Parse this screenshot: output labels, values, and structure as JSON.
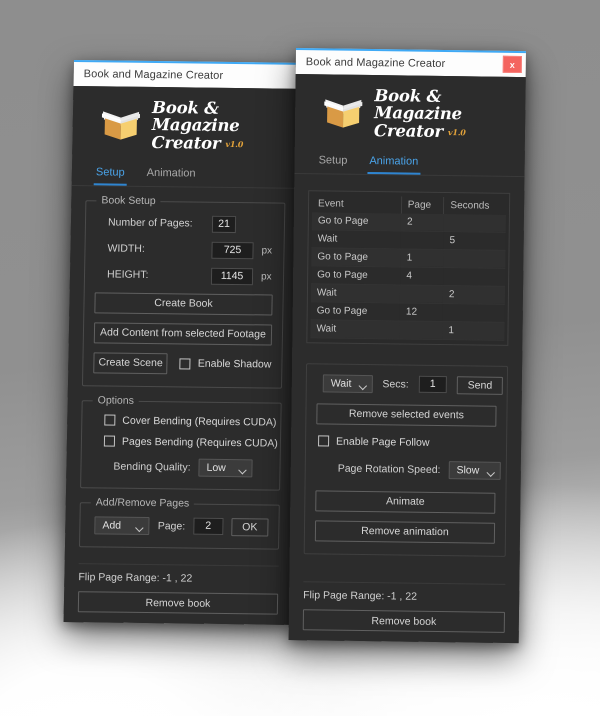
{
  "background": {
    "top_color": "#8e8e8e",
    "bottom_color": "#ffffff"
  },
  "theme": {
    "panel_bg": "#2c2c2c",
    "accent_blue": "#3fa9f5",
    "close_red": "#f4645f",
    "logo_orange": "#e2a23a"
  },
  "logo": {
    "line1": "Book & Magazine",
    "line2": "Creator",
    "version": "v1.0",
    "icon": "open-book-icon"
  },
  "left_window": {
    "titlebar": {
      "title": "Book and Magazine Creator"
    },
    "tabs": [
      {
        "label": "Setup",
        "active": true
      },
      {
        "label": "Animation",
        "active": false
      }
    ],
    "book_setup": {
      "title": "Book Setup",
      "pages_label": "Number of Pages:",
      "pages_value": "21",
      "width_label": "WIDTH:",
      "width_value": "725",
      "width_unit": "px",
      "height_label": "HEIGHT:",
      "height_value": "1145",
      "height_unit": "px",
      "create_book": "Create Book",
      "add_content": "Add Content from selected Footage",
      "create_scene": "Create Scene",
      "enable_shadow": "Enable Shadow",
      "enable_shadow_checked": false
    },
    "options": {
      "title": "Options",
      "cover_bending": "Cover Bending (Requires CUDA)",
      "cover_bending_checked": false,
      "pages_bending": "Pages Bending (Requires CUDA)",
      "pages_bending_checked": false,
      "bending_quality_label": "Bending Quality:",
      "bending_quality_value": "Low"
    },
    "add_remove": {
      "title": "Add/Remove Pages",
      "action_value": "Add",
      "page_label": "Page:",
      "page_value": "2",
      "ok_label": "OK"
    },
    "footer": {
      "flip_range": "Flip Page Range: -1 , 22",
      "remove_book": "Remove book"
    }
  },
  "right_window": {
    "titlebar": {
      "title": "Book and Magazine Creator",
      "close_label": "x"
    },
    "tabs": [
      {
        "label": "Setup",
        "active": false
      },
      {
        "label": "Animation",
        "active": true
      }
    ],
    "events_table": {
      "columns": [
        "Event",
        "Page",
        "Seconds"
      ],
      "rows": [
        {
          "event": "Go to Page",
          "page": "2",
          "seconds": ""
        },
        {
          "event": "Wait",
          "page": "",
          "seconds": "5"
        },
        {
          "event": "Go to Page",
          "page": "1",
          "seconds": ""
        },
        {
          "event": "Go to Page",
          "page": "4",
          "seconds": ""
        },
        {
          "event": "Wait",
          "page": "",
          "seconds": "2"
        },
        {
          "event": "Go to Page",
          "page": "12",
          "seconds": ""
        },
        {
          "event": "Wait",
          "page": "",
          "seconds": "1"
        }
      ]
    },
    "controls": {
      "event_type_value": "Wait",
      "secs_label": "Secs:",
      "secs_value": "1",
      "send_label": "Send",
      "remove_selected": "Remove selected events",
      "enable_page_follow": "Enable Page Follow",
      "enable_page_follow_checked": false,
      "rotation_speed_label": "Page Rotation Speed:",
      "rotation_speed_value": "Slow",
      "animate": "Animate",
      "remove_animation": "Remove animation"
    },
    "footer": {
      "flip_range": "Flip Page Range: -1 , 22",
      "remove_book": "Remove book"
    }
  }
}
